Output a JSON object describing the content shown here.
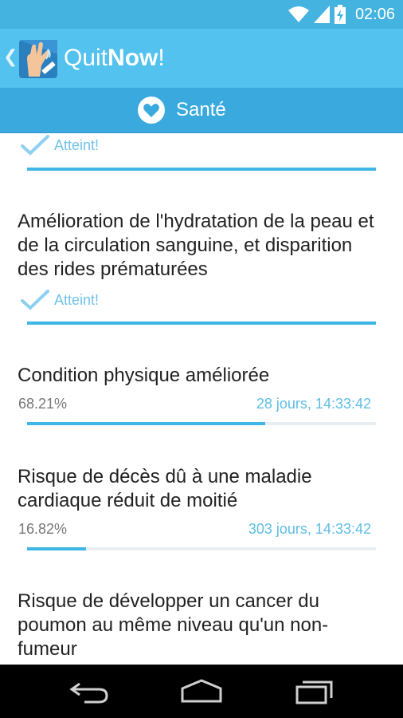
{
  "status_bar": {
    "time": "02:06",
    "icons": [
      "wifi-icon",
      "signal-icon",
      "battery-charging-icon"
    ]
  },
  "action_bar": {
    "title_light": "Quit",
    "title_bold": "Now",
    "title_suffix": "!",
    "icons": [
      "back-chevron-icon",
      "app-logo-icon"
    ]
  },
  "tab": {
    "label": "Santé",
    "icon": "heart-icon"
  },
  "health_items": [
    {
      "status": "Atteint!",
      "progress": 1.0
    },
    {
      "title": "Amélioration de l'hydratation de la peau et de la circulation sanguine, et disparition des rides prématurées",
      "status": "Atteint!",
      "progress": 1.0
    },
    {
      "title": "Condition physique améliorée",
      "percent": "68.21%",
      "remaining": "28 jours, 14:33:42",
      "progress": 0.6821
    },
    {
      "title": "Risque de décès dû à une maladie cardiaque réduit de moitié",
      "percent": "16.82%",
      "remaining": "303 jours, 14:33:42",
      "progress": 0.1682
    },
    {
      "title": "Risque de développer un cancer du poumon au même niveau qu'un non-fumeur"
    }
  ],
  "nav_bar": {
    "icons": [
      "back-icon",
      "home-icon",
      "recent-apps-icon"
    ]
  },
  "colors": {
    "status_bar": "#44b3e0",
    "action_bar": "#53c2ef",
    "tab_bar": "#3aa9de",
    "progress": "#3fb6e6",
    "achieved": "#6fc2ea"
  }
}
